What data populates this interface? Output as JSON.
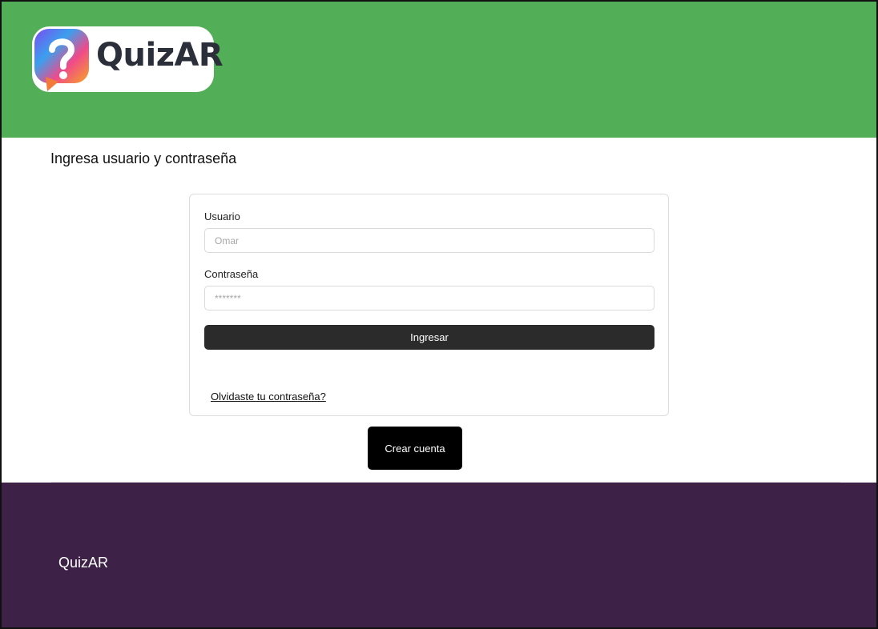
{
  "header": {
    "logo_text": "QuizAR",
    "logo_icon": "question-bubble-icon"
  },
  "login": {
    "subtitle": "Ingresa usuario y contraseña",
    "username_label": "Usuario",
    "username_placeholder": "Omar",
    "password_label": "Contraseña",
    "password_placeholder": "*******",
    "submit_label": "Ingresar",
    "forgot_link": "Olvidaste tu contraseña?",
    "create_account_label": "Crear cuenta"
  },
  "footer": {
    "brand": "QuizAR"
  },
  "colors": {
    "header_bg": "#52ae57",
    "footer_bg": "#3d2146",
    "primary_button": "#2b2b2b",
    "create_button": "#000000"
  }
}
